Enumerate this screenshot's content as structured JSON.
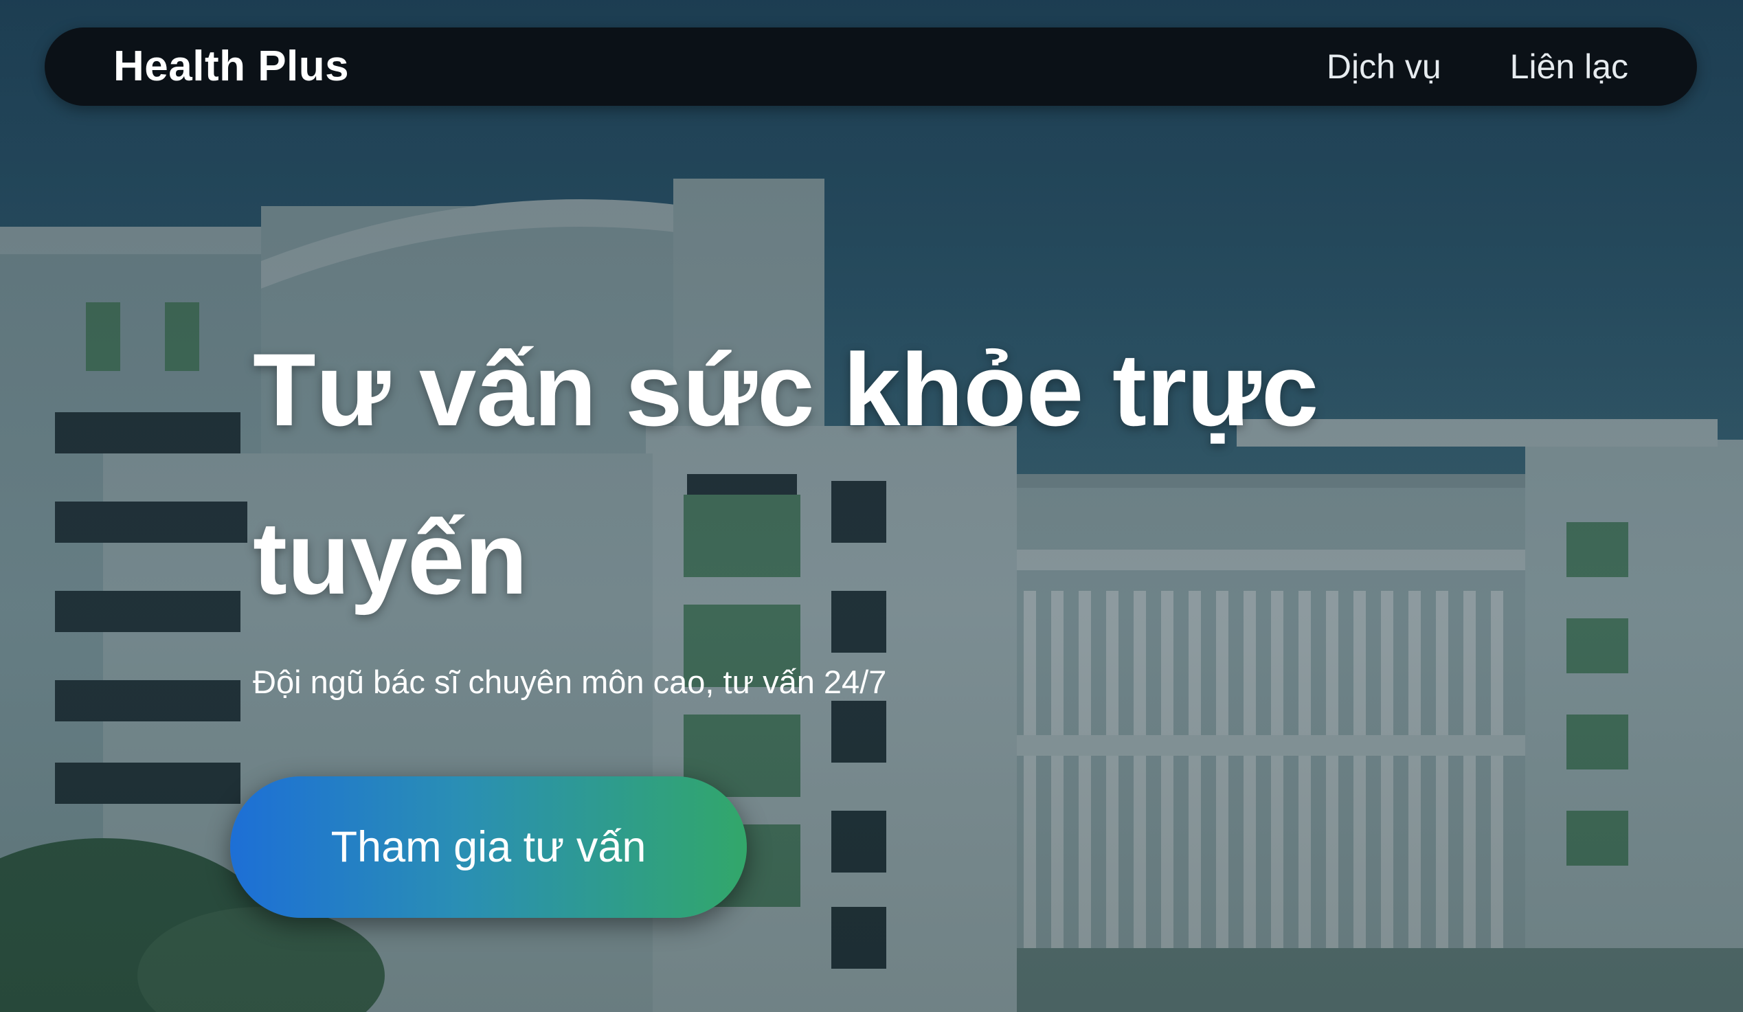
{
  "navbar": {
    "brand": "Health Plus",
    "links": [
      {
        "label": "Dịch vụ"
      },
      {
        "label": "Liên lạc"
      }
    ]
  },
  "hero": {
    "title": "Tư vấn sức khỏe trực tuyến",
    "subtitle": "Đội ngũ bác sĩ chuyên môn cao, tư vấn 24/7",
    "cta_label": "Tham gia tư vấn"
  },
  "colors": {
    "navbar_bg": "#0b1117",
    "cta_gradient_start": "#1d6fd6",
    "cta_gradient_end": "#32a76a",
    "text": "#ffffff"
  },
  "background": {
    "icon": "hospital-building-image"
  }
}
